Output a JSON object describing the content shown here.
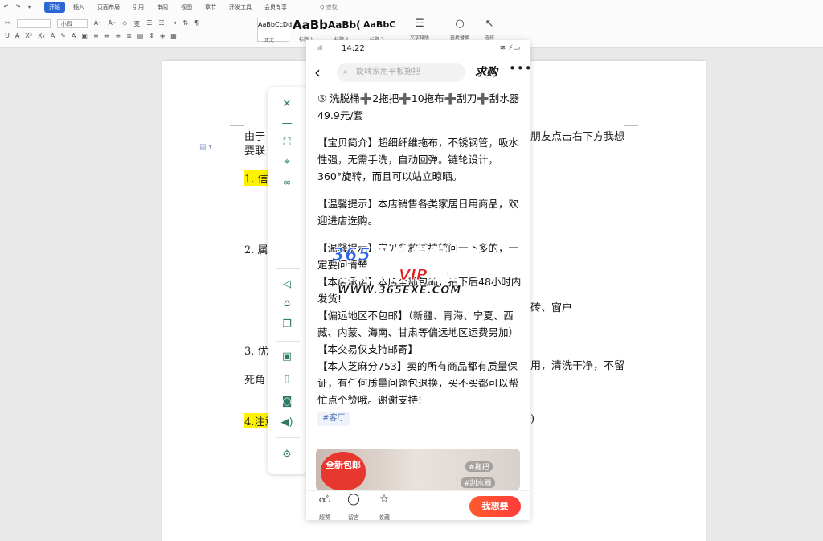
{
  "ribbon": {
    "quick_access": "↶ ↷ ▾",
    "tabs": [
      "开始",
      "插入",
      "页面布局",
      "引用",
      "审阅",
      "视图",
      "章节",
      "开发工具",
      "会员专享"
    ],
    "search": "Q 查找",
    "font_name": "",
    "font_size": "小四",
    "styles": [
      {
        "sample": "AaBbCcDd",
        "name": "正文"
      },
      {
        "sample": "AaBb",
        "name": "标题 1"
      },
      {
        "sample": "AaBb(",
        "name": "标题 2"
      },
      {
        "sample": "AaBbC",
        "name": "标题 3"
      }
    ],
    "tools": [
      {
        "icon": "text-layout-icon",
        "label": "文字排版"
      },
      {
        "icon": "search-icon",
        "label": "查找替换"
      },
      {
        "icon": "cursor-icon",
        "label": "选择"
      }
    ]
  },
  "document": {
    "line1_left": "由于",
    "line1_right": "朋友点击右下方我想",
    "line2_left": "要联",
    "item1": "1. 信",
    "item2": "2. 属",
    "item2_right": "砖、窗户",
    "item3": "3. 优",
    "item3_right": "用，清洗干净，不留",
    "item3_line2": "死角",
    "item4": "4.注意",
    "item4_right": ")"
  },
  "phone": {
    "time": "14:22",
    "search_placeholder": "旋转家用平板拖把",
    "qiugou": "求购",
    "title": "⑤ 洗脱桶➕2拖把➕10拖布➕刮刀➕刮水器                  49.9元/套",
    "intro": "【宝贝简介】超细纤维拖布，不锈钢管，吸水性强，无需手洗，自动回弹。链轮设计，360°旋转，而且可以站立晾晒。",
    "tip1": "【温馨提示】本店销售各类家居日用商品，欢迎进店选购。",
    "tip2": "【温馨提示】宝贝多款式拍前问一下多的，一定要问清楚",
    "shipping": "【本店承诺】本店全部包邮，拍下后48小时内发货!",
    "remote": "【偏远地区不包邮】（新疆、青海、宁夏、西藏、内蒙、海南、甘肃等偏远地区运费另加）",
    "mail": "【本交易仅支持邮寄】",
    "credit": "【本人芝麻分753】卖的所有商品都有质量保证，有任何质量问题包退换，买不买都可以帮忙点个赞哦。谢谢支持!",
    "tag": "#客厅",
    "banner_heart": "全新包邮",
    "banner_tag1": "#拖把",
    "banner_tag2": "#刮水器",
    "bottom": [
      {
        "icon": "thumb-up-icon",
        "label": "超赞"
      },
      {
        "icon": "comment-icon",
        "label": "留言"
      },
      {
        "icon": "star-icon",
        "label": "收藏"
      }
    ],
    "want_button": "我想要"
  },
  "watermark": {
    "line1": "365网络学院",
    "line2": "收录全网VIP教程",
    "line3": "WWW.365EXE.COM"
  },
  "colors": {
    "accent": "#2b68d6",
    "highlight": "#fff200",
    "want": "#ff4a30",
    "toolbar_icon": "#2f7a69"
  }
}
